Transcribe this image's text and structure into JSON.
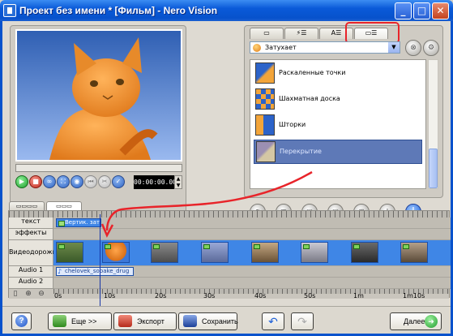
{
  "window": {
    "title": "Проект без имени * [Фильм] - Nero Vision",
    "minimize_glyph": "_",
    "maximize_glyph": "□",
    "close_glyph": "✕"
  },
  "preview": {
    "timecode": "00:00:00.00",
    "progress": 0.0
  },
  "effects": {
    "tabs": [
      "▭",
      "⚡☰",
      "A☰",
      "▭☰"
    ],
    "active_tab": 3,
    "category": "Затухает",
    "items": [
      {
        "label": "Раскаленные точки",
        "selected": false
      },
      {
        "label": "Шахматная доска",
        "selected": false
      },
      {
        "label": "Шторки",
        "selected": false
      },
      {
        "label": "Перекрытие",
        "selected": true
      }
    ],
    "add_glyph": "+"
  },
  "timeline": {
    "tabs": [
      "▭▭▭▭",
      "▭▭▭"
    ],
    "rows": {
      "text": "текст",
      "effects": "эффекты",
      "video": "Видеодорожка",
      "audio1": "Audio 1",
      "audio2": "Audio 2"
    },
    "text_clip": "Вертик. зат",
    "audio_clip": "chelovek_sobake_drug",
    "scale_labels": [
      "0s",
      "10s",
      "20s",
      "30s",
      "40s",
      "50s",
      "1m",
      "1m10s"
    ]
  },
  "bottom": {
    "help": "?",
    "more": "Еще >>",
    "export": "Экспорт",
    "save": "Сохранить",
    "next": "Далее"
  },
  "colors": {
    "titlebar": "#0752cc",
    "track_blue": "#3f86e6",
    "annotation_red": "#e8242a",
    "selection": "#5e79b7"
  }
}
